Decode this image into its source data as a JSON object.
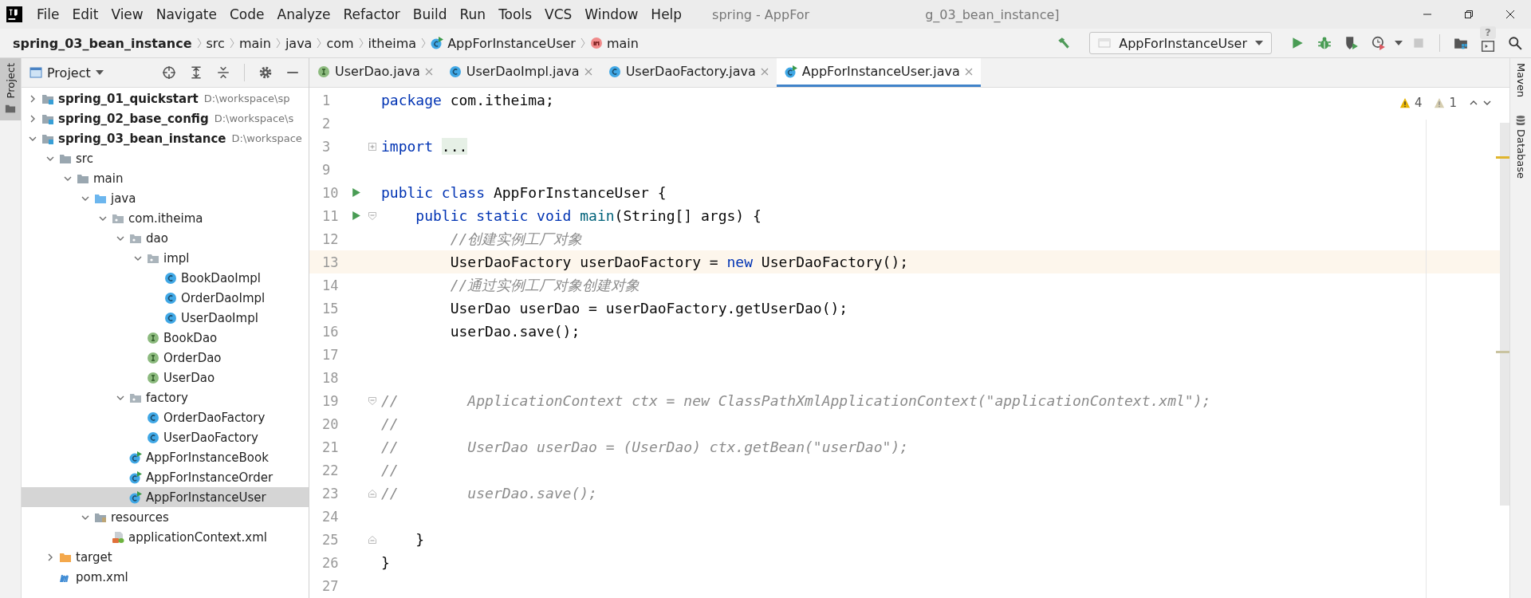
{
  "window": {
    "title_parts": [
      "spring - AppFor",
      "g_03_bean_instance]"
    ]
  },
  "menu": [
    "File",
    "Edit",
    "View",
    "Navigate",
    "Code",
    "Analyze",
    "Refactor",
    "Build",
    "Run",
    "Tools",
    "VCS",
    "Window",
    "Help"
  ],
  "breadcrumbs": [
    {
      "label": "spring_03_bean_instance",
      "kind": "module"
    },
    {
      "label": "src",
      "kind": "plain"
    },
    {
      "label": "main",
      "kind": "plain"
    },
    {
      "label": "java",
      "kind": "plain"
    },
    {
      "label": "com",
      "kind": "plain"
    },
    {
      "label": "itheima",
      "kind": "plain"
    },
    {
      "label": "AppForInstanceUser",
      "kind": "class"
    },
    {
      "label": "main",
      "kind": "method"
    }
  ],
  "toolbar": {
    "run_config": "AppForInstanceUser",
    "stop_disabled": true,
    "help_label": "?"
  },
  "left_strip": {
    "label": "Project"
  },
  "right_strip": [
    {
      "label": "Maven",
      "kind": "maven"
    },
    {
      "label": "Database",
      "kind": "database"
    }
  ],
  "project_panel": {
    "title": "Project",
    "tree": [
      {
        "label": "spring_01_quickstart",
        "kind": "module",
        "path": "D:\\workspace\\sp",
        "expanded": false,
        "selected": false
      },
      {
        "label": "spring_02_base_config",
        "kind": "module",
        "path": "D:\\workspace\\s",
        "expanded": false,
        "selected": false
      },
      {
        "label": "spring_03_bean_instance",
        "kind": "module",
        "path": "D:\\workspace",
        "expanded": true,
        "selected": false,
        "children": [
          {
            "label": "src",
            "kind": "folder",
            "expanded": true,
            "selected": false,
            "children": [
              {
                "label": "main",
                "kind": "folder",
                "expanded": true,
                "selected": false,
                "children": [
                  {
                    "label": "java",
                    "kind": "source",
                    "expanded": true,
                    "selected": false,
                    "children": [
                      {
                        "label": "com.itheima",
                        "kind": "package",
                        "expanded": true,
                        "selected": false,
                        "children": [
                          {
                            "label": "dao",
                            "kind": "package",
                            "expanded": true,
                            "selected": false,
                            "children": [
                              {
                                "label": "impl",
                                "kind": "package",
                                "expanded": true,
                                "selected": false,
                                "children": [
                                  {
                                    "label": "BookDaoImpl",
                                    "kind": "class",
                                    "selected": false
                                  },
                                  {
                                    "label": "OrderDaoImpl",
                                    "kind": "class",
                                    "selected": false
                                  },
                                  {
                                    "label": "UserDaoImpl",
                                    "kind": "class",
                                    "selected": false
                                  }
                                ]
                              },
                              {
                                "label": "BookDao",
                                "kind": "interface",
                                "selected": false
                              },
                              {
                                "label": "OrderDao",
                                "kind": "interface",
                                "selected": false
                              },
                              {
                                "label": "UserDao",
                                "kind": "interface",
                                "selected": false
                              }
                            ]
                          },
                          {
                            "label": "factory",
                            "kind": "package",
                            "expanded": true,
                            "selected": false,
                            "children": [
                              {
                                "label": "OrderDaoFactory",
                                "kind": "class",
                                "selected": false
                              },
                              {
                                "label": "UserDaoFactory",
                                "kind": "class",
                                "selected": false
                              }
                            ]
                          },
                          {
                            "label": "AppForInstanceBook",
                            "kind": "main-class",
                            "selected": false
                          },
                          {
                            "label": "AppForInstanceOrder",
                            "kind": "main-class",
                            "selected": false
                          },
                          {
                            "label": "AppForInstanceUser",
                            "kind": "main-class",
                            "selected": true
                          }
                        ]
                      }
                    ]
                  },
                  {
                    "label": "resources",
                    "kind": "resources",
                    "expanded": true,
                    "selected": false,
                    "children": [
                      {
                        "label": "applicationContext.xml",
                        "kind": "xml",
                        "selected": false
                      }
                    ]
                  }
                ]
              }
            ]
          },
          {
            "label": "target",
            "kind": "excluded",
            "expanded": false,
            "selected": false
          },
          {
            "label": "pom.xml",
            "kind": "maven",
            "selected": false
          }
        ]
      }
    ]
  },
  "tabs": [
    {
      "label": "UserDao.java",
      "kind": "interface",
      "selected": false
    },
    {
      "label": "UserDaoImpl.java",
      "kind": "class",
      "selected": false
    },
    {
      "label": "UserDaoFactory.java",
      "kind": "class",
      "selected": false
    },
    {
      "label": "AppForInstanceUser.java",
      "kind": "main-class",
      "selected": true
    }
  ],
  "inspections": {
    "warnings": "4",
    "weak_warnings": "1"
  },
  "editor": {
    "lines": [
      {
        "number": "1",
        "kind": "plain",
        "runnable": false,
        "current": false,
        "tokens": [
          {
            "kind": "keyword",
            "text": "package"
          },
          {
            "kind": "plain",
            "text": " com.itheima;"
          }
        ]
      },
      {
        "number": "2",
        "kind": "plain",
        "runnable": false,
        "current": false
      },
      {
        "number": "3",
        "kind": "fold-expand",
        "runnable": false,
        "current": false,
        "tokens": [
          {
            "kind": "keyword",
            "text": "import "
          },
          {
            "kind": "folded",
            "text": "..."
          }
        ]
      },
      {
        "number": "9",
        "kind": "plain",
        "runnable": false,
        "current": false
      },
      {
        "number": "10",
        "kind": "plain",
        "runnable": true,
        "current": false,
        "tokens": [
          {
            "kind": "keyword",
            "text": "public class"
          },
          {
            "kind": "plain",
            "text": " AppForInstanceUser {"
          }
        ]
      },
      {
        "number": "11",
        "kind": "fold-start",
        "runnable": true,
        "current": false,
        "tokens": [
          {
            "kind": "keyword",
            "text": "    public static void "
          },
          {
            "kind": "method",
            "text": "main"
          },
          {
            "kind": "plain",
            "text": "(String[] args) {"
          }
        ]
      },
      {
        "number": "12",
        "kind": "plain",
        "runnable": false,
        "current": false,
        "tokens": [
          {
            "kind": "comment",
            "text": "        //创建实例工厂对象"
          }
        ]
      },
      {
        "number": "13",
        "kind": "plain",
        "runnable": false,
        "current": true,
        "tokens": [
          {
            "kind": "plain",
            "text": "        UserDaoFactory userDaoFactory = "
          },
          {
            "kind": "keyword",
            "text": "new"
          },
          {
            "kind": "plain",
            "text": " UserDaoFactory();"
          }
        ]
      },
      {
        "number": "14",
        "kind": "plain",
        "runnable": false,
        "current": false,
        "tokens": [
          {
            "kind": "comment",
            "text": "        //通过实例工厂对象创建对象"
          }
        ]
      },
      {
        "number": "15",
        "kind": "plain",
        "runnable": false,
        "current": false,
        "tokens": [
          {
            "kind": "plain",
            "text": "        UserDao userDao = userDaoFactory.getUserDao();"
          }
        ]
      },
      {
        "number": "16",
        "kind": "plain",
        "runnable": false,
        "current": false,
        "tokens": [
          {
            "kind": "plain",
            "text": "        userDao.save();"
          }
        ]
      },
      {
        "number": "17",
        "kind": "plain",
        "runnable": false,
        "current": false
      },
      {
        "number": "18",
        "kind": "plain",
        "runnable": false,
        "current": false
      },
      {
        "number": "19",
        "kind": "fold-start",
        "runnable": false,
        "current": false,
        "tokens": [
          {
            "kind": "comment",
            "text": "//        ApplicationContext ctx = new ClassPathXmlApplicationContext(\"applicationContext.xml\");"
          }
        ]
      },
      {
        "number": "20",
        "kind": "plain",
        "runnable": false,
        "current": false,
        "tokens": [
          {
            "kind": "comment",
            "text": "//"
          }
        ]
      },
      {
        "number": "21",
        "kind": "plain",
        "runnable": false,
        "current": false,
        "tokens": [
          {
            "kind": "comment",
            "text": "//        UserDao userDao = (UserDao) ctx.getBean(\"userDao\");"
          }
        ]
      },
      {
        "number": "22",
        "kind": "plain",
        "runnable": false,
        "current": false,
        "tokens": [
          {
            "kind": "comment",
            "text": "//"
          }
        ]
      },
      {
        "number": "23",
        "kind": "fold-end",
        "runnable": false,
        "current": false,
        "tokens": [
          {
            "kind": "comment",
            "text": "//        userDao.save();"
          }
        ]
      },
      {
        "number": "24",
        "kind": "plain",
        "runnable": false,
        "current": false
      },
      {
        "number": "25",
        "kind": "fold-end",
        "runnable": false,
        "current": false,
        "tokens": [
          {
            "kind": "plain",
            "text": "    }"
          }
        ]
      },
      {
        "number": "26",
        "kind": "plain",
        "runnable": false,
        "current": false,
        "tokens": [
          {
            "kind": "plain",
            "text": "}"
          }
        ]
      },
      {
        "number": "27",
        "kind": "plain",
        "runnable": false,
        "current": false
      }
    ]
  }
}
